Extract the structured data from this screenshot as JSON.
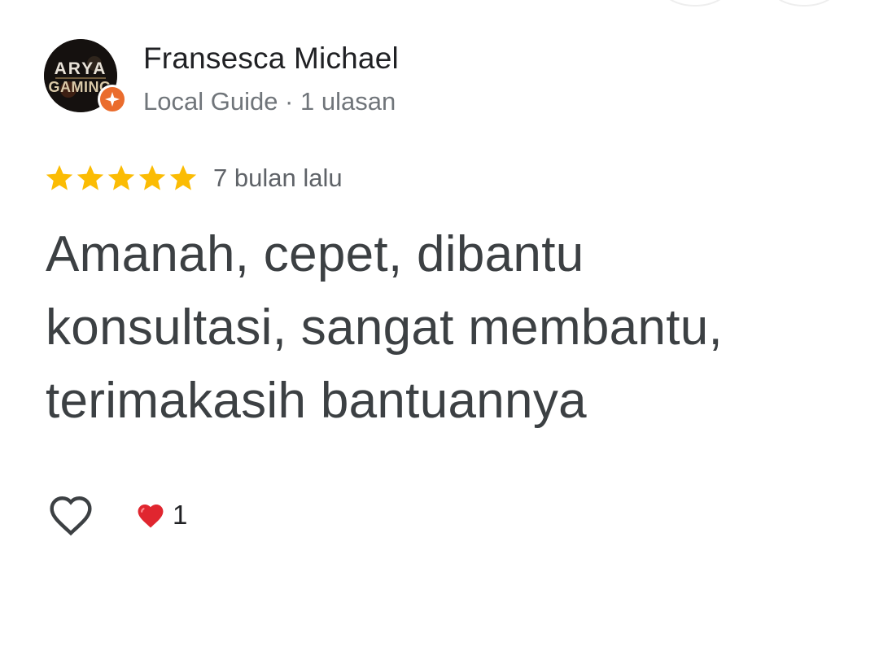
{
  "reviewer": {
    "name": "Fransesca Michael",
    "meta": "Local Guide · 1 ulasan",
    "avatar_text_line1": "ARYA",
    "avatar_text_line2": "GAMING"
  },
  "review": {
    "rating": 5,
    "max_rating": 5,
    "time": "7 bulan lalu",
    "text": "Amanah, cepet, dibantu konsultasi, sangat membantu, terimakasih bantuannya"
  },
  "reactions": {
    "like_icon": "heart-outline-icon",
    "reaction_icon": "red-heart-icon",
    "count": "1"
  },
  "colors": {
    "star": "#fbbc04",
    "badge": "#ea6c2d",
    "heart": "#e0262f"
  }
}
